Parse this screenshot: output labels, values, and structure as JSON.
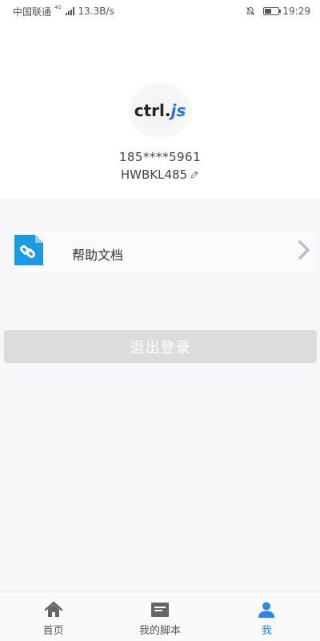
{
  "status_bar": {
    "carrier": "中国联通",
    "network_type": "4G",
    "speed": "13.3B/s",
    "time": "19:29",
    "battery_level": 0.5
  },
  "profile": {
    "avatar_text_left": "ctrl.",
    "avatar_text_right": "js",
    "phone": "185****5961",
    "username": "HWBKL485"
  },
  "menu": {
    "items": [
      {
        "label": "帮助文档",
        "icon": "link-document-icon"
      }
    ]
  },
  "logout": {
    "label": "退出登录"
  },
  "bottom_nav": {
    "items": [
      {
        "label": "首页",
        "icon": "home-icon"
      },
      {
        "label": "我的脚本",
        "icon": "script-icon"
      },
      {
        "label": "我",
        "icon": "user-icon",
        "active": true
      }
    ]
  },
  "colors": {
    "accent": "#2f86e0",
    "doc_icon": "#1e9be0",
    "logout_bg": "#dcdcdc"
  }
}
